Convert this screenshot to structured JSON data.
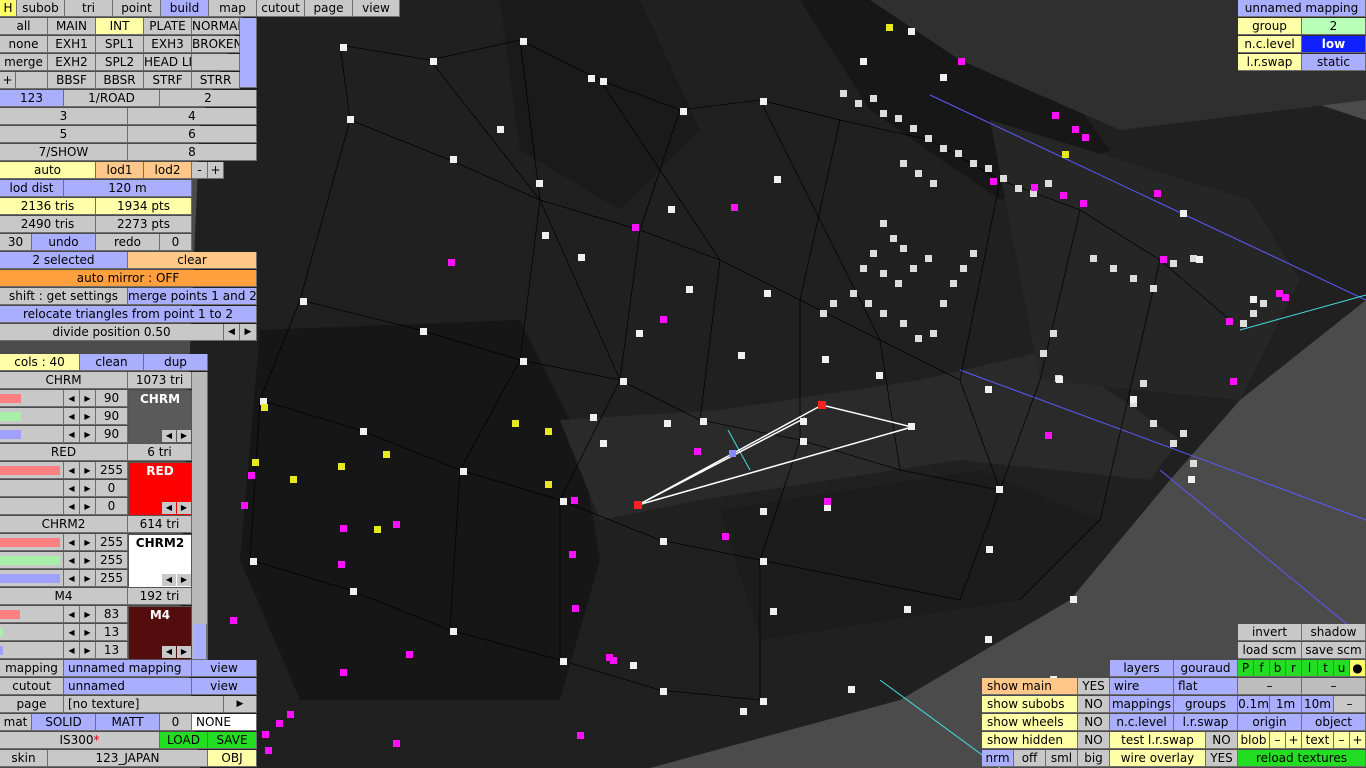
{
  "toolbar": {
    "tabs": [
      "H",
      "subob",
      "tri",
      "point",
      "build",
      "map",
      "cutout",
      "page",
      "view"
    ],
    "active": "build"
  },
  "groups": {
    "row1": [
      "all",
      "MAIN",
      "INT",
      "PLATE",
      "NORMAL"
    ],
    "row2": [
      "none",
      "EXH1",
      "SPL1",
      "EXH3",
      "BROKEN"
    ],
    "row3": [
      "merge",
      "EXH2",
      "SPL2",
      "HEAD LI",
      ""
    ],
    "row4": [
      "+",
      "",
      "BBSF",
      "BBSR",
      "STRF",
      "STRR"
    ]
  },
  "layers": {
    "row1": [
      "123",
      "1/ROAD",
      "2"
    ],
    "row2": [
      "3",
      "4"
    ],
    "row3": [
      "5",
      "6"
    ],
    "row4": [
      "7/SHOW",
      "8"
    ]
  },
  "lod": {
    "auto": "auto",
    "lod1": "lod1",
    "lod2": "lod2",
    "minus": "-",
    "plus": "+",
    "dist_label": "lod dist",
    "dist_value": "120 m"
  },
  "stats": {
    "tris1": "2136 tris",
    "pts1": "1934 pts",
    "tris2": "2490 tris",
    "pts2": "2273 pts"
  },
  "undo": {
    "count": "30",
    "undo": "undo",
    "redo": "redo",
    "redo_count": "0"
  },
  "selection": {
    "selected": "2 selected",
    "clear": "clear",
    "auto_mirror": "auto mirror : OFF",
    "shift": "shift : get settings",
    "merge": "merge points 1 and 2",
    "relocate": "relocate triangles from point 1 to 2",
    "divide": "divide position 0.50",
    "prev": "◀",
    "next": "▶"
  },
  "colors_header": {
    "cols": "cols : 40",
    "clean": "clean",
    "dup": "dup"
  },
  "materials": [
    {
      "name": "CHRM",
      "tris": "1073 tri",
      "r": "90",
      "g": "90",
      "b": "90",
      "swatch": "CHRM",
      "swatch_color": "#5a5a5a",
      "text_color": "#ffffff",
      "rf": 0.35,
      "gf": 0.35,
      "bf": 0.35
    },
    {
      "name": "RED",
      "tris": "6 tri",
      "r": "255",
      "g": "0",
      "b": "0",
      "swatch": "RED",
      "swatch_color": "#ff0000",
      "text_color": "#ffffff",
      "rf": 1.0,
      "gf": 0.0,
      "bf": 0.0
    },
    {
      "name": "CHRM2",
      "tris": "614 tri",
      "r": "255",
      "g": "255",
      "b": "255",
      "swatch": "CHRM2",
      "swatch_color": "#ffffff",
      "text_color": "#000000",
      "rf": 1.0,
      "gf": 1.0,
      "bf": 1.0
    },
    {
      "name": "M4",
      "tris": "192 tri",
      "r": "83",
      "g": "13",
      "b": "13",
      "swatch": "M4",
      "swatch_color": "#530d0d",
      "text_color": "#ffffff",
      "rf": 0.33,
      "gf": 0.05,
      "bf": 0.05
    }
  ],
  "bottom_left": {
    "mapping_label": "mapping",
    "mapping_value": "unnamed mapping",
    "mapping_view": "view",
    "cutout_label": "cutout",
    "cutout_value": "unnamed",
    "cutout_view": "view",
    "page_label": "page",
    "page_value": "[no texture]",
    "page_arrow": "▶",
    "mat": "mat",
    "solid": "SOLID",
    "matt": "MATT",
    "zero": "0",
    "none": "NONE",
    "file": "IS300",
    "modified": "*",
    "load": "LOAD",
    "save": "SAVE",
    "skin_label": "skin",
    "skin_value": "123_JAPAN",
    "obj": "OBJ"
  },
  "top_right": {
    "mapping": "unnamed mapping",
    "group_label": "group",
    "group_value": "2",
    "nclevel_label": "n.c.level",
    "nclevel_value": "low",
    "lrswap_label": "l.r.swap",
    "lrswap_value": "static"
  },
  "bottom_right": {
    "invert": "invert",
    "shadow": "shadow",
    "load_scm": "load scm",
    "save_scm": "save scm",
    "layers": "layers",
    "gouraud": "gouraud",
    "wire": "wire",
    "flat": "flat",
    "mappings": "mappings",
    "groups": "groups",
    "nclevel": "n.c.level",
    "lrswap": "l.r.swap",
    "test_lrswap": "test l.r.swap",
    "test_lrswap_val": "NO",
    "wire_overlay": "wire overlay",
    "wire_overlay_val": "YES",
    "show_main": "show main",
    "show_main_val": "YES",
    "show_subobs": "show subobs",
    "show_subobs_val": "NO",
    "show_wheels": "show wheels",
    "show_wheels_val": "NO",
    "show_hidden": "show hidden",
    "show_hidden_val": "NO",
    "nrm": "nrm",
    "off": "off",
    "sml": "sml",
    "big": "big",
    "view_keys": [
      "P",
      "f",
      "b",
      "r",
      "l",
      "t",
      "u",
      "●"
    ],
    "dash1": "–",
    "dash2": "–",
    "d01": "0.1m",
    "d1": "1m",
    "d10": "10m",
    "dash3": "–",
    "origin": "origin",
    "object": "object",
    "blob": "blob",
    "blob_minus": "–",
    "blob_plus": "+",
    "text": "text",
    "text_minus": "–",
    "text_plus": "+",
    "reload": "reload textures"
  }
}
